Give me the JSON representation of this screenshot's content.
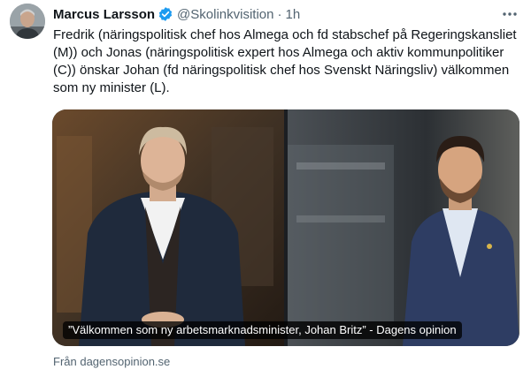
{
  "author": {
    "name": "Marcus Larsson",
    "handle": "@Skolinkvisition",
    "separator": "·",
    "time": "1h"
  },
  "icons": {
    "verified": "verified-badge-icon",
    "more": "more-options-icon",
    "verified_color": "#1d9bf0"
  },
  "tweet": {
    "text": "Fredrik (näringspolitisk chef hos Almega och fd stabschef på Regeringskansliet (M)) och Jonas (näringspolitisk expert hos Almega och aktiv kommunpolitiker (C)) önskar Johan (fd näringspolitisk chef hos Svenskt Näringsliv) välkommen som ny minister (L)."
  },
  "card": {
    "caption": "”Välkommen som ny arbetsmarknadsminister, Johan Britz” - Dagens opinion",
    "source": "Från dagensopinion.se"
  }
}
